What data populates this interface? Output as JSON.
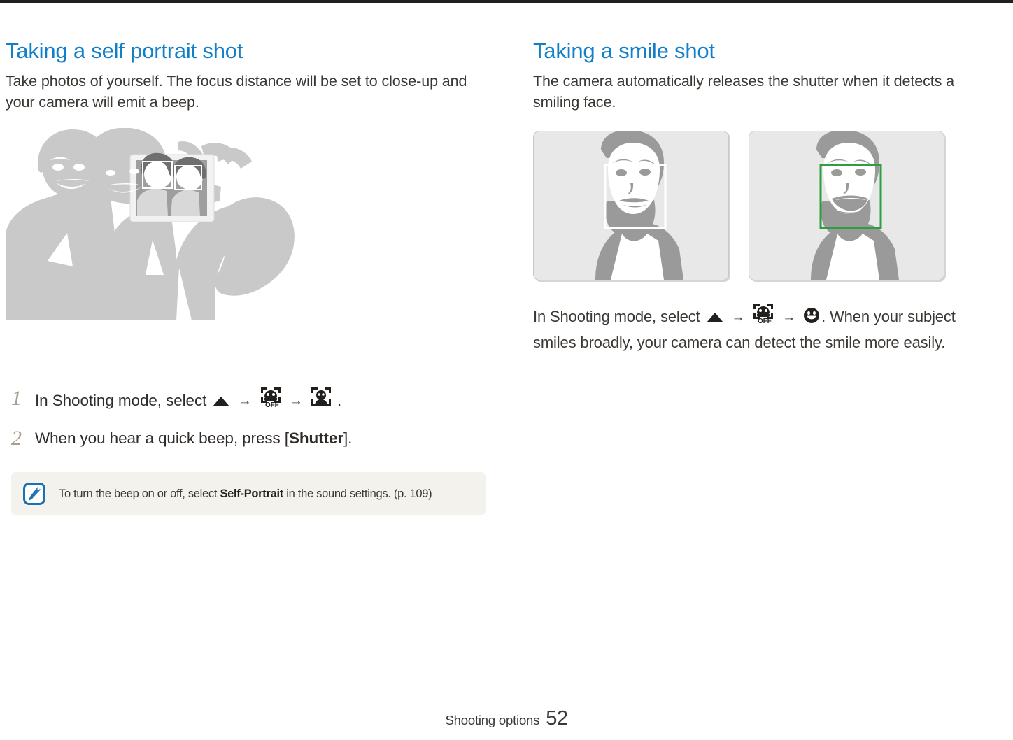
{
  "document": {
    "type": "camera-user-manual-page",
    "footer": {
      "section": "Shooting options",
      "page_number": "52"
    },
    "accent_color": "#1280c8",
    "step_number_color": "#a79e8c",
    "note_background": "#f4f2ec",
    "top_bar_color": "#231f1c"
  },
  "left_column": {
    "heading": "Taking a self portrait shot",
    "intro": "Take photos of yourself. The focus distance will be set to close-up and your camera will emit a beep.",
    "illustration": {
      "name": "self-portrait-illustration",
      "description": "Two people taking a self portrait with a camera held at arm's length; the camera screen shows both faces with detection frames"
    },
    "steps": [
      {
        "number": "1",
        "text_before": "In Shooting mode, select",
        "icons": [
          "up-arrow-icon",
          "face-detection-off-icon",
          "self-portrait-icon"
        ],
        "text_after": "."
      },
      {
        "number": "2",
        "text_before": "When you hear a quick beep, press [",
        "bold": "Shutter",
        "text_after": "]."
      }
    ],
    "note": {
      "icon": "note-pen-icon",
      "text_before": "To turn the beep on or off, select ",
      "bold": "Self-Portrait",
      "text_after": " in the sound settings. (p. 109)"
    }
  },
  "right_column": {
    "heading": "Taking a smile shot",
    "intro": "The camera automatically releases the shutter when it detects a smiling face.",
    "photos": [
      {
        "name": "photo-neutral-face",
        "caption_alt": "Woman with neutral expression, white face detection frame",
        "frame_color": "#ffffff"
      },
      {
        "name": "photo-smiling-face",
        "caption_alt": "Woman smiling, green face detection frame",
        "frame_color": "#2f9e41"
      }
    ],
    "paragraph": {
      "text_before": "In Shooting mode, select",
      "icons": [
        "up-arrow-icon",
        "face-detection-off-icon",
        "smile-icon"
      ],
      "text_after": ". When your subject smiles broadly, your camera can detect the smile more easily."
    }
  }
}
